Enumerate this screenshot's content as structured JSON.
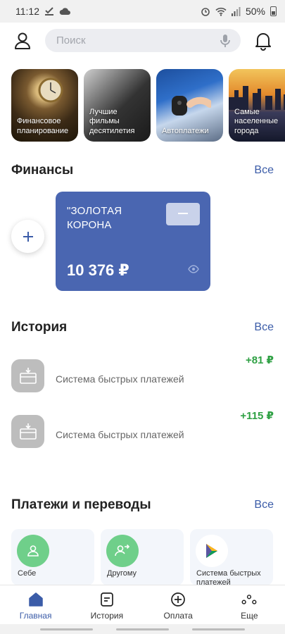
{
  "status_bar": {
    "time": "11:12",
    "battery": "50%"
  },
  "search": {
    "placeholder": "Поиск"
  },
  "stories": [
    {
      "label": "Финансовое планирование"
    },
    {
      "label": "Лучшие фильмы десятилетия"
    },
    {
      "label": "Автоплатежи"
    },
    {
      "label": "Самые населенные города"
    }
  ],
  "finance": {
    "title": "Финансы",
    "all_link": "Все",
    "card": {
      "name": "\"ЗОЛОТАЯ КОРОНА",
      "balance": "10 376 ₽"
    }
  },
  "history": {
    "title": "История",
    "all_link": "Все",
    "items": [
      {
        "title": "Система быстрых платежей",
        "amount": "+81 ₽"
      },
      {
        "title": "Система быстрых платежей",
        "amount": "+115 ₽"
      }
    ]
  },
  "payments": {
    "title": "Платежи и переводы",
    "all_link": "Все",
    "items": [
      {
        "label": "Себе"
      },
      {
        "label": "Другому"
      },
      {
        "label": "Система быстрых платежей"
      }
    ]
  },
  "nav": {
    "items": [
      {
        "label": "Главная"
      },
      {
        "label": "История"
      },
      {
        "label": "Оплата"
      },
      {
        "label": "Еще"
      }
    ]
  },
  "colors": {
    "accent": "#3b5ca8",
    "card": "#4a66b1",
    "positive": "#2ea043",
    "pay_green": "#6fcf8a"
  }
}
